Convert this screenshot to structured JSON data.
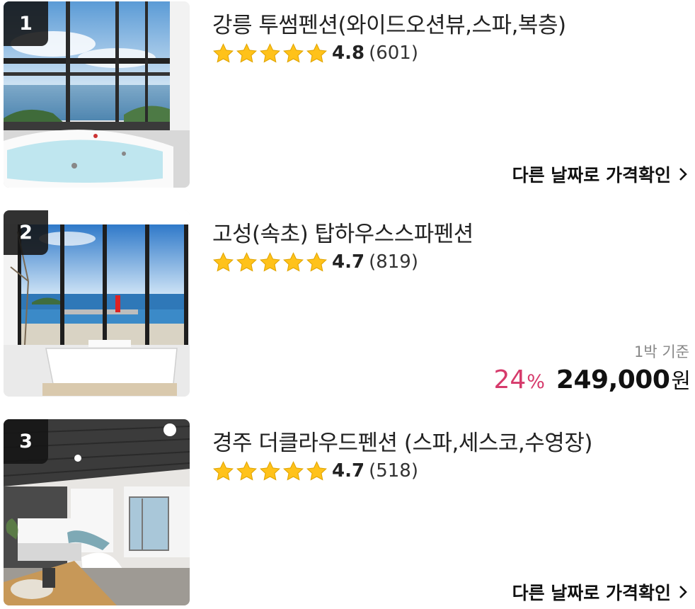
{
  "listings": [
    {
      "rank": "1",
      "name": "강릉 투썸펜션(와이드오션뷰,스파,복층)",
      "rating": "4.8",
      "review_count": "(601)",
      "stars_filled": 5,
      "cta": "다른 날짜로 가격확인",
      "photo_icon": "ocean-view-spa-photo"
    },
    {
      "rank": "2",
      "name": "고성(속초) 탑하우스스파펜션",
      "rating": "4.7",
      "review_count": "(819)",
      "stars_filled": 5,
      "price_basis": "1박 기준",
      "discount": "24",
      "discount_unit": "%",
      "price": "249,000",
      "currency": "원",
      "photo_icon": "lighthouse-spa-photo"
    },
    {
      "rank": "3",
      "name": "경주 더클라우드펜션 (스파,세스코,수영장)",
      "rating": "4.7",
      "review_count": "(518)",
      "stars_filled": 5,
      "cta": "다른 날짜로 가격확인",
      "photo_icon": "bedroom-interior-photo"
    }
  ],
  "colors": {
    "star": "#FFC21A",
    "discount": "#d63a6b",
    "rank_badge": "#141414"
  }
}
